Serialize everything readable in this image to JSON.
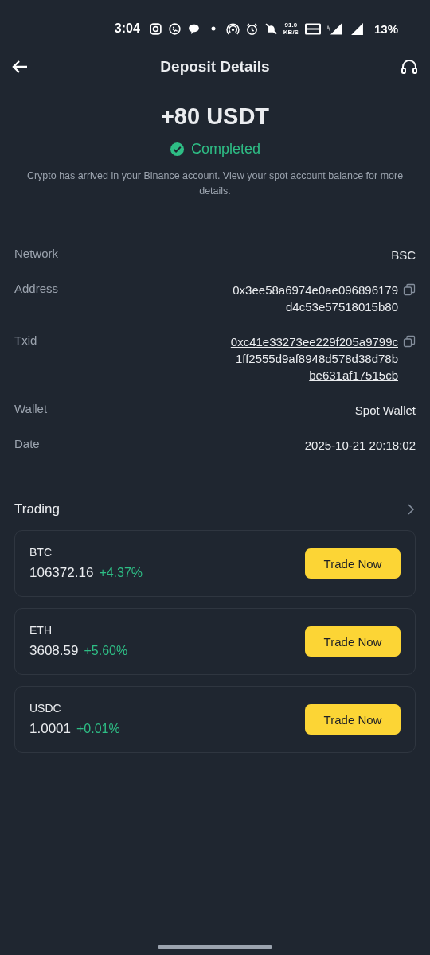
{
  "status_bar": {
    "time": "3:04",
    "speed": "91.0",
    "speed_unit": "KB/S",
    "battery": "13%"
  },
  "header": {
    "title": "Deposit Details"
  },
  "summary": {
    "amount": "+80 USDT",
    "status": "Completed",
    "message": "Crypto has arrived in your Binance account. View your spot account balance for more details."
  },
  "details": [
    {
      "label": "Network",
      "lines": [
        "BSC"
      ],
      "copy": false,
      "link": false
    },
    {
      "label": "Address",
      "lines": [
        "0x3ee58a6974e0ae096896179",
        "d4c53e57518015b80"
      ],
      "copy": true,
      "link": false
    },
    {
      "label": "Txid",
      "lines": [
        "0xc41e33273ee229f205a9799c",
        "1ff2555d9af8948d578d38d78b",
        "be631af17515cb"
      ],
      "copy": true,
      "link": true
    },
    {
      "label": "Wallet",
      "lines": [
        "Spot Wallet"
      ],
      "copy": false,
      "link": false
    },
    {
      "label": "Date",
      "lines": [
        "2025-10-21 20:18:02"
      ],
      "copy": false,
      "link": false
    }
  ],
  "trading": {
    "title": "Trading",
    "pairs": [
      {
        "symbol": "BTC",
        "price": "106372.16",
        "change": "+4.37%",
        "up": true,
        "button": "Trade Now"
      },
      {
        "symbol": "ETH",
        "price": "3608.59",
        "change": "+5.60%",
        "up": true,
        "button": "Trade Now"
      },
      {
        "symbol": "USDC",
        "price": "1.0001",
        "change": "+0.01%",
        "up": true,
        "button": "Trade Now"
      }
    ]
  }
}
